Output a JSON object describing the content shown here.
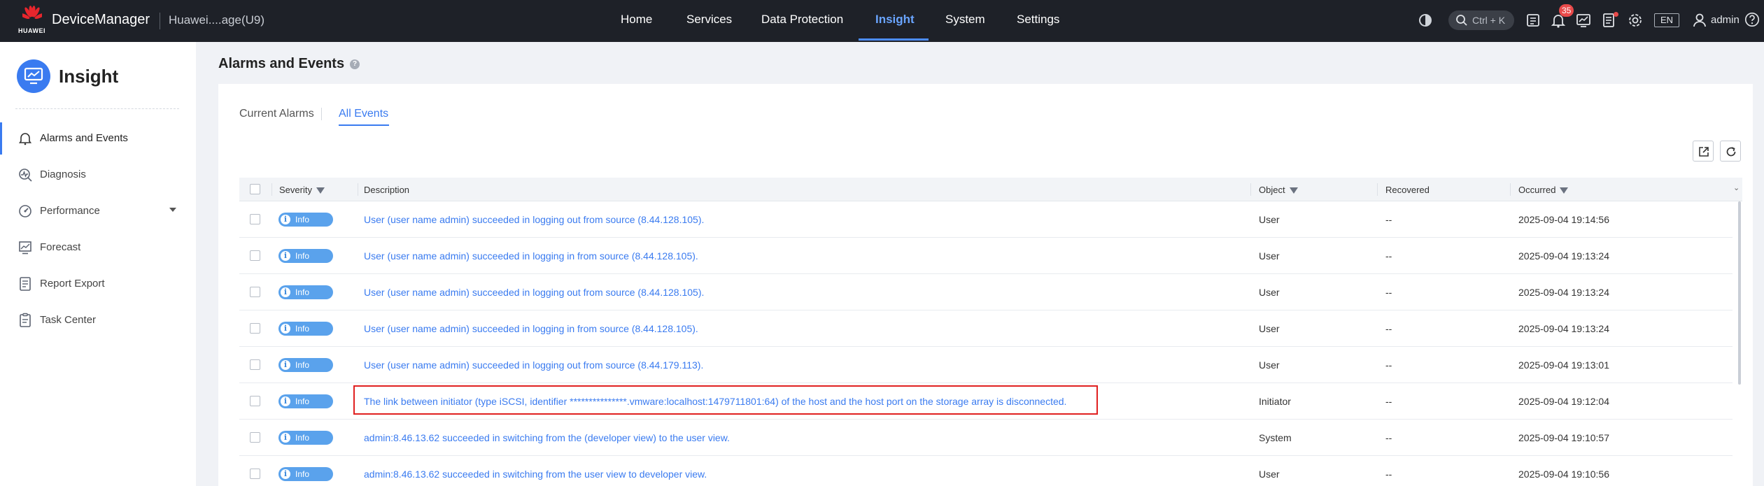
{
  "header": {
    "brand": "HUAWEI",
    "app_name": "DeviceManager",
    "device_name": "Huawei....age(U9)",
    "nav": [
      {
        "label": "Home"
      },
      {
        "label": "Services"
      },
      {
        "label": "Data Protection"
      },
      {
        "label": "Insight"
      },
      {
        "label": "System"
      },
      {
        "label": "Settings"
      }
    ],
    "active_nav": "Insight",
    "search_shortcut": "Ctrl + K",
    "alarm_count": "35",
    "language": "EN",
    "user": "admin",
    "icons": [
      "theme-icon",
      "search-icon",
      "task-icon",
      "bell-icon",
      "monitor-icon",
      "log-icon",
      "gear-icon",
      "user-icon",
      "help-icon"
    ]
  },
  "sidebar": {
    "title": "Insight",
    "items": [
      {
        "label": "Alarms and Events",
        "icon": "bell-icon"
      },
      {
        "label": "Diagnosis",
        "icon": "diagnosis-icon"
      },
      {
        "label": "Performance",
        "icon": "gauge-icon"
      },
      {
        "label": "Forecast",
        "icon": "chart-icon"
      },
      {
        "label": "Report Export",
        "icon": "report-icon"
      },
      {
        "label": "Task Center",
        "icon": "clipboard-icon"
      }
    ],
    "active": "Alarms and Events"
  },
  "main": {
    "title": "Alarms and Events",
    "tabs": [
      {
        "label": "Current Alarms"
      },
      {
        "label": "All Events"
      }
    ],
    "active_tab": "All Events",
    "table": {
      "columns": [
        "Severity",
        "Description",
        "Object",
        "Recovered",
        "Occurred"
      ],
      "rows": [
        {
          "severity": "Info",
          "description": "User (user name admin) succeeded in logging out from source (8.44.128.105).",
          "object": "User",
          "recovered": "--",
          "occurred": "2025-09-04 19:14:56"
        },
        {
          "severity": "Info",
          "description": "User (user name admin) succeeded in logging in from source (8.44.128.105).",
          "object": "User",
          "recovered": "--",
          "occurred": "2025-09-04 19:13:24"
        },
        {
          "severity": "Info",
          "description": "User (user name admin) succeeded in logging out from source (8.44.128.105).",
          "object": "User",
          "recovered": "--",
          "occurred": "2025-09-04 19:13:24"
        },
        {
          "severity": "Info",
          "description": "User (user name admin) succeeded in logging in from source (8.44.128.105).",
          "object": "User",
          "recovered": "--",
          "occurred": "2025-09-04 19:13:24"
        },
        {
          "severity": "Info",
          "description": "User (user name admin) succeeded in logging out from source (8.44.179.113).",
          "object": "User",
          "recovered": "--",
          "occurred": "2025-09-04 19:13:01"
        },
        {
          "severity": "Info",
          "description": "The link between initiator (type iSCSI, identifier ***************.vmware:localhost:1479711801:64) of the host and the host port on the storage array is disconnected.",
          "object": "Initiator",
          "recovered": "--",
          "occurred": "2025-09-04 19:12:04"
        },
        {
          "severity": "Info",
          "description": "admin:8.46.13.62 succeeded in switching from the (developer view) to the user view.",
          "object": "System",
          "recovered": "--",
          "occurred": "2025-09-04 19:10:57"
        },
        {
          "severity": "Info",
          "description": "admin:8.46.13.62 succeeded in switching from the user view to developer view.",
          "object": "User",
          "recovered": "--",
          "occurred": "2025-09-04 19:10:56"
        }
      ]
    }
  },
  "colors": {
    "topbar": "#1e2128",
    "accent": "#3a7bf0",
    "info_badge": "#5aa2ec",
    "highlight": "#e02020"
  }
}
